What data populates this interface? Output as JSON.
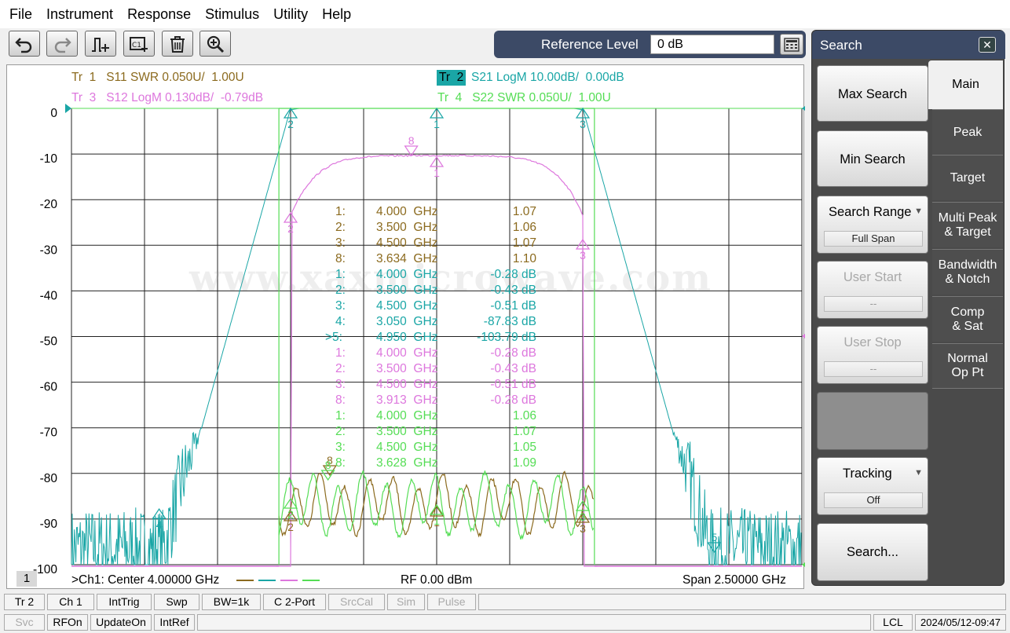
{
  "menu": [
    "File",
    "Instrument",
    "Response",
    "Stimulus",
    "Utility",
    "Help"
  ],
  "toolbar": {
    "buttons": [
      "undo-icon",
      "redo-icon",
      "add-marker-icon",
      "add-channel-icon",
      "delete-icon",
      "zoom-icon"
    ]
  },
  "reference_level": {
    "label": "Reference Level",
    "value": "0 dB"
  },
  "traces": {
    "tr1": "Tr  1   S11 SWR 0.050U/  1.00U",
    "tr2_tag": "Tr  2",
    "tr2": "S21 LogM 10.00dB/  0.00dB",
    "tr3": "Tr  3   S12 LogM 0.130dB/  -0.79dB",
    "tr4": "Tr  4   S22 SWR 0.050U/  1.00U"
  },
  "colors": {
    "tr1": "#8b6a1e",
    "tr2": "#1aa6a6",
    "tr3": "#dd77dd",
    "tr4": "#55dd55",
    "panel": "#3c4a66"
  },
  "watermark": "www.xaxmicrowave.com",
  "y_ticks": [
    "0",
    "-10",
    "-20",
    "-30",
    "-40",
    "-50",
    "-60",
    "-70",
    "-80",
    "-90",
    "-100"
  ],
  "marker_table": [
    {
      "id": "1:",
      "freq": "4.000  GHz",
      "val": "1.07",
      "trace": "tr1"
    },
    {
      "id": "2:",
      "freq": "3.500  GHz",
      "val": "1.06",
      "trace": "tr1"
    },
    {
      "id": "3:",
      "freq": "4.500  GHz",
      "val": "1.07",
      "trace": "tr1"
    },
    {
      "id": "8:",
      "freq": "3.634  GHz",
      "val": "1.10",
      "trace": "tr1"
    },
    {
      "id": "1:",
      "freq": "4.000  GHz",
      "val": "-0.28 dB",
      "trace": "tr2"
    },
    {
      "id": "2:",
      "freq": "3.500  GHz",
      "val": "-0.43 dB",
      "trace": "tr2"
    },
    {
      "id": "3:",
      "freq": "4.500  GHz",
      "val": "-0.51 dB",
      "trace": "tr2"
    },
    {
      "id": "4:",
      "freq": "3.050  GHz",
      "val": "-87.83 dB",
      "trace": "tr2"
    },
    {
      "id": ">5:",
      "freq": "4.950  GHz",
      "val": "-103.79 dB",
      "trace": "tr2"
    },
    {
      "id": "1:",
      "freq": "4.000  GHz",
      "val": "-0.28 dB",
      "trace": "tr3"
    },
    {
      "id": "2:",
      "freq": "3.500  GHz",
      "val": "-0.43 dB",
      "trace": "tr3"
    },
    {
      "id": "3:",
      "freq": "4.500  GHz",
      "val": "-0.51 dB",
      "trace": "tr3"
    },
    {
      "id": "8:",
      "freq": "3.913  GHz",
      "val": "-0.28 dB",
      "trace": "tr3"
    },
    {
      "id": "1:",
      "freq": "4.000  GHz",
      "val": "1.06",
      "trace": "tr4"
    },
    {
      "id": "2:",
      "freq": "3.500  GHz",
      "val": "1.07",
      "trace": "tr4"
    },
    {
      "id": "3:",
      "freq": "4.500  GHz",
      "val": "1.05",
      "trace": "tr4"
    },
    {
      "id": "8:",
      "freq": "3.628  GHz",
      "val": "1.09",
      "trace": "tr4"
    }
  ],
  "chart_status": {
    "channel_num": "1",
    "center": ">Ch1:  Center  4.00000 GHz",
    "rf": "RF    0.00 dBm",
    "span": "Span  2.50000 GHz"
  },
  "chart_data": {
    "type": "line",
    "x_range": [
      2.75,
      5.25
    ],
    "x_unit": "GHz",
    "ylim": [
      -100,
      0
    ],
    "ylabel_ticks": [
      0,
      -10,
      -20,
      -30,
      -40,
      -50,
      -60,
      -70,
      -80,
      -90,
      -100
    ],
    "series": [
      {
        "name": "S21 LogM",
        "trace": "tr2",
        "markers": [
          [
            4.0,
            -0.28
          ],
          [
            3.5,
            -0.43
          ],
          [
            4.5,
            -0.51
          ],
          [
            3.05,
            -87.83
          ],
          [
            4.95,
            -103.79
          ]
        ]
      },
      {
        "name": "S12 LogM",
        "trace": "tr3",
        "markers": [
          [
            4.0,
            -0.28
          ],
          [
            3.5,
            -0.43
          ],
          [
            4.5,
            -0.51
          ],
          [
            3.913,
            -0.28
          ]
        ]
      },
      {
        "name": "S11 SWR",
        "trace": "tr1",
        "markers": [
          [
            4.0,
            1.07
          ],
          [
            3.5,
            1.06
          ],
          [
            4.5,
            1.07
          ],
          [
            3.634,
            1.1
          ]
        ]
      },
      {
        "name": "S22 SWR",
        "trace": "tr4",
        "markers": [
          [
            4.0,
            1.06
          ],
          [
            3.5,
            1.07
          ],
          [
            4.5,
            1.05
          ],
          [
            3.628,
            1.09
          ]
        ]
      }
    ]
  },
  "search_panel": {
    "title": "Search",
    "softkeys": {
      "max_search": "Max Search",
      "min_search": "Min Search",
      "search_range": "Search Range",
      "search_range_value": "Full Span",
      "user_start": "User Start",
      "user_start_value": "--",
      "user_stop": "User Stop",
      "user_stop_value": "--",
      "tracking": "Tracking",
      "tracking_value": "Off",
      "search_dots": "Search..."
    },
    "tabs": [
      "Main",
      "Peak",
      "Target",
      "Multi Peak\n& Target",
      "Bandwidth\n& Notch",
      "Comp\n& Sat",
      "Normal\nOp Pt"
    ]
  },
  "bottom_row1": [
    "Tr 2",
    "Ch 1",
    "IntTrig",
    "Swp",
    "BW=1k",
    "C  2-Port",
    "SrcCal",
    "Sim",
    "Pulse"
  ],
  "bottom_row2": [
    "Svc",
    "RFOn",
    "UpdateOn",
    "IntRef",
    "LCL",
    "2024/05/12-09:47"
  ]
}
